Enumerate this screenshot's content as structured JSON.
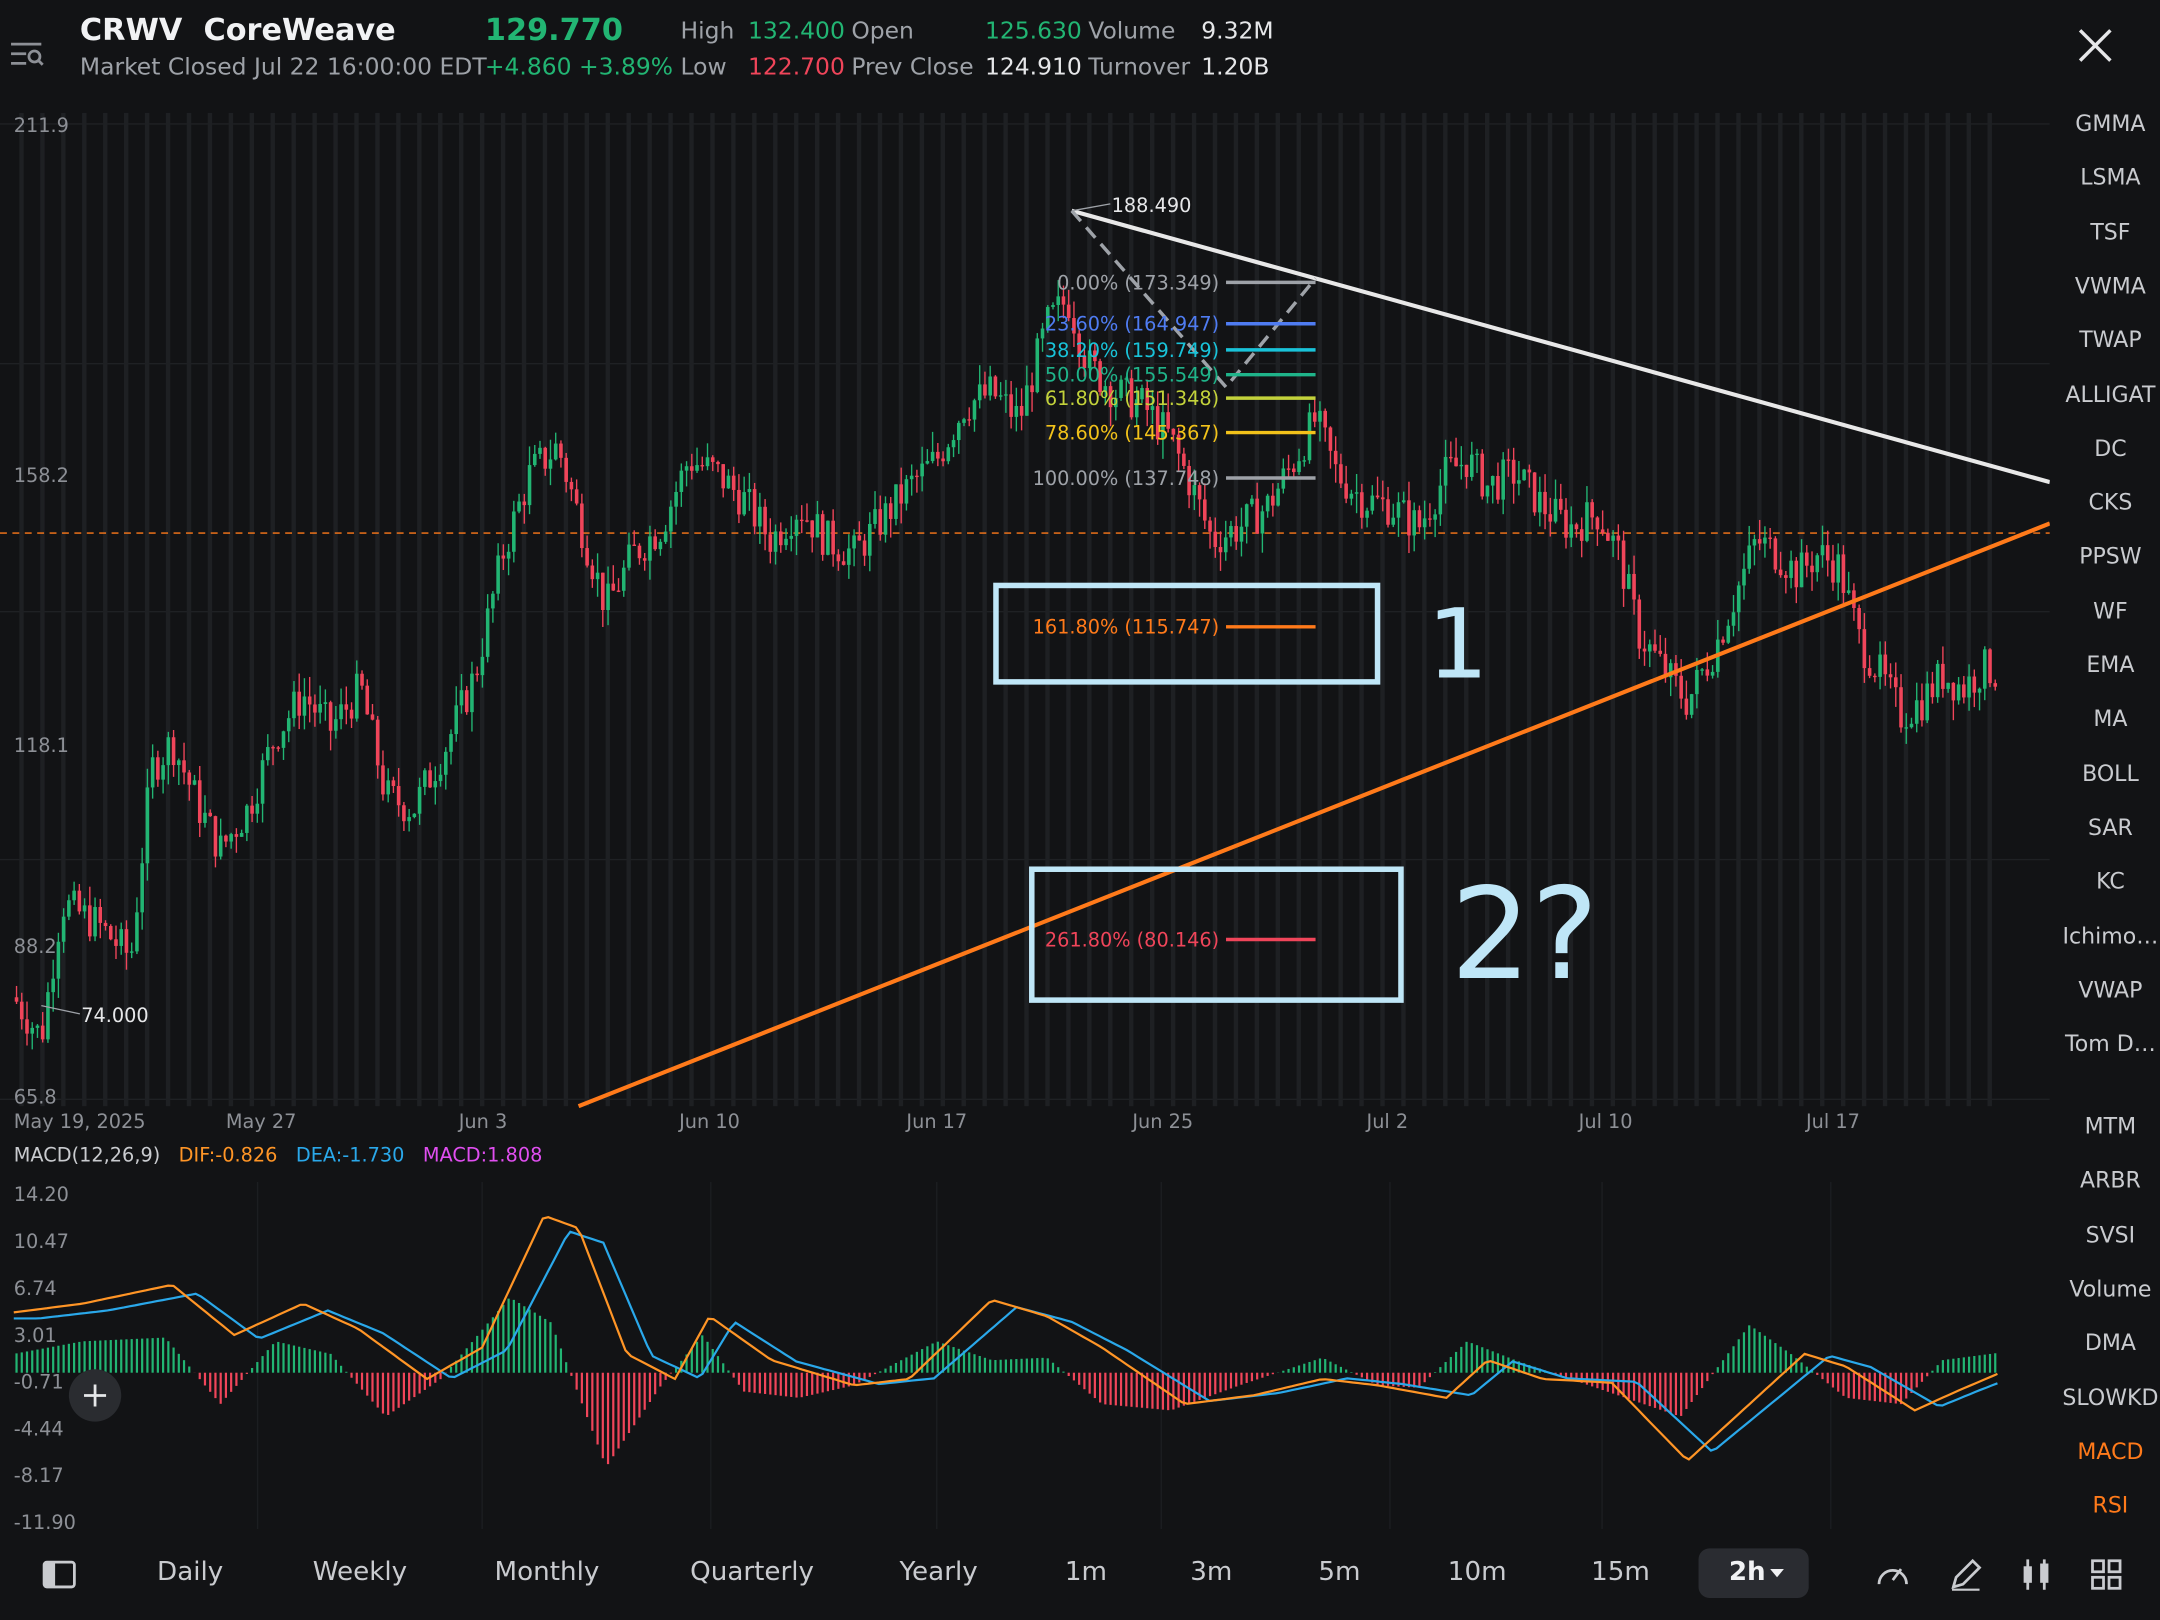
{
  "header": {
    "symbol": "CRWV",
    "name": "CoreWeave",
    "price": "129.770",
    "status": "Market Closed Jul 22 16:00:00 EDT",
    "change": "+4.860 +3.89%",
    "stats": {
      "high_label": "High",
      "high": "132.400",
      "low_label": "Low",
      "low": "122.700",
      "open_label": "Open",
      "open": "125.630",
      "prev_close_label": "Prev Close",
      "prev_close": "124.910",
      "volume_label": "Volume",
      "volume": "9.32M",
      "turnover_label": "Turnover",
      "turnover": "1.20B"
    }
  },
  "indicators": [
    "GMMA",
    "LSMA",
    "TSF",
    "VWMA",
    "TWAP",
    "ALLIGAT",
    "DC",
    "CKS",
    "PPSW",
    "WF",
    "EMA",
    "MA",
    "BOLL",
    "SAR",
    "KC",
    "Ichimo…",
    "VWAP",
    "Tom D…",
    "MTM",
    "ARBR",
    "SVSI",
    "Volume",
    "DMA",
    "SLOWKD",
    "MACD",
    "RSI"
  ],
  "active_indicators": [
    "MACD",
    "RSI"
  ],
  "colors": {
    "up": "#22b573",
    "down": "#f0455a",
    "orange": "#ff7a1a",
    "trend_white": "#e8e8e8",
    "annotation_box": "#bfe6f7",
    "dif": "#ff9526",
    "dea": "#2aa8ea"
  },
  "chart_data": [
    {
      "type": "candlestick",
      "symbol": "CRWV",
      "interval": "2h",
      "y_axis_ticks": [
        "211.9",
        "158.2",
        "118.1",
        "88.2",
        "65.8"
      ],
      "x_axis_ticks": [
        "May 19, 2025",
        "May 27",
        "Jun 3",
        "Jun 10",
        "Jun 17",
        "Jun 25",
        "Jul 2",
        "Jul 10",
        "Jul 17"
      ],
      "ylim": [
        65.8,
        211.9
      ],
      "last_price_line": 129.77,
      "high_marker": "188.490",
      "low_marker": "74.000",
      "fibonacci": [
        {
          "label": "0.00% (173.349)",
          "color": "#9ea2a8"
        },
        {
          "label": "23.60% (164.947)",
          "color": "#4f7cf2"
        },
        {
          "label": "38.20% (159.749)",
          "color": "#19c3d9"
        },
        {
          "label": "50.00% (155.549)",
          "color": "#1fb48a"
        },
        {
          "label": "61.80% (151.348)",
          "color": "#c3d23b"
        },
        {
          "label": "78.60% (145.367)",
          "color": "#f2c21a"
        },
        {
          "label": "100.00% (137.748)",
          "color": "#9ea2a8"
        },
        {
          "label": "161.80% (115.747)",
          "color": "#ff7a1a"
        },
        {
          "label": "261.80% (80.146)",
          "color": "#f0455a"
        }
      ],
      "annotations": [
        "1",
        "2?"
      ]
    },
    {
      "type": "line",
      "title": "MACD(12,26,9)",
      "dif_label": "DIF:-0.826",
      "dea_label": "DEA:-1.730",
      "macd_label": "MACD:1.808",
      "y_axis_ticks": [
        "14.20",
        "10.47",
        "6.74",
        "3.01",
        "-0.71",
        "-4.44",
        "-8.17",
        "-11.90"
      ],
      "ylim": [
        -11.9,
        14.2
      ]
    }
  ],
  "toolbar": {
    "periods": [
      "Daily",
      "Weekly",
      "Monthly",
      "Quarterly",
      "Yearly",
      "1m",
      "3m",
      "5m",
      "10m",
      "15m"
    ],
    "active": "2h"
  }
}
